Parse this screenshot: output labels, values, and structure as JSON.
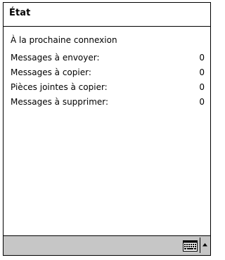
{
  "window": {
    "title": "État"
  },
  "status": {
    "heading": "À la prochaine connexion",
    "rows": [
      {
        "label": "Messages à envoyer:",
        "value": "0"
      },
      {
        "label": "Messages à copier:",
        "value": "0"
      },
      {
        "label": "Pièces jointes à copier:",
        "value": "0"
      },
      {
        "label": "Messages à supprimer:",
        "value": "0"
      }
    ]
  },
  "bottom_bar": {
    "keyboard_icon": "keyboard-icon",
    "arrow_icon": "up-arrow-icon"
  },
  "colors": {
    "background": "#ffffff",
    "border": "#000000",
    "bottom_bar": "#c6c6c6"
  }
}
